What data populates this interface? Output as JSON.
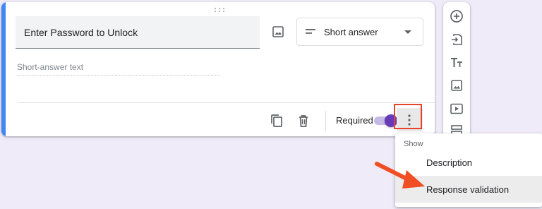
{
  "question": {
    "title": "Enter Password to Unlock",
    "answer_placeholder": "Short-answer text"
  },
  "type_select": {
    "selected": "Short answer",
    "icon": "short-text-icon"
  },
  "footer": {
    "required_label": "Required",
    "required_on": true,
    "icons": [
      "duplicate-icon",
      "trash-icon",
      "more-vert-icon"
    ]
  },
  "toolbar": {
    "icons": [
      "add-question-icon",
      "import-questions-icon",
      "title-text-icon",
      "image-icon",
      "video-icon",
      "section-icon"
    ]
  },
  "menu": {
    "header": "Show",
    "items": [
      {
        "label": "Description"
      },
      {
        "label": "Response validation"
      }
    ]
  },
  "colors": {
    "accent": "#4285f4",
    "toggle": "#673ab7",
    "highlight": "#e8412c",
    "background": "#f0ebf8"
  }
}
